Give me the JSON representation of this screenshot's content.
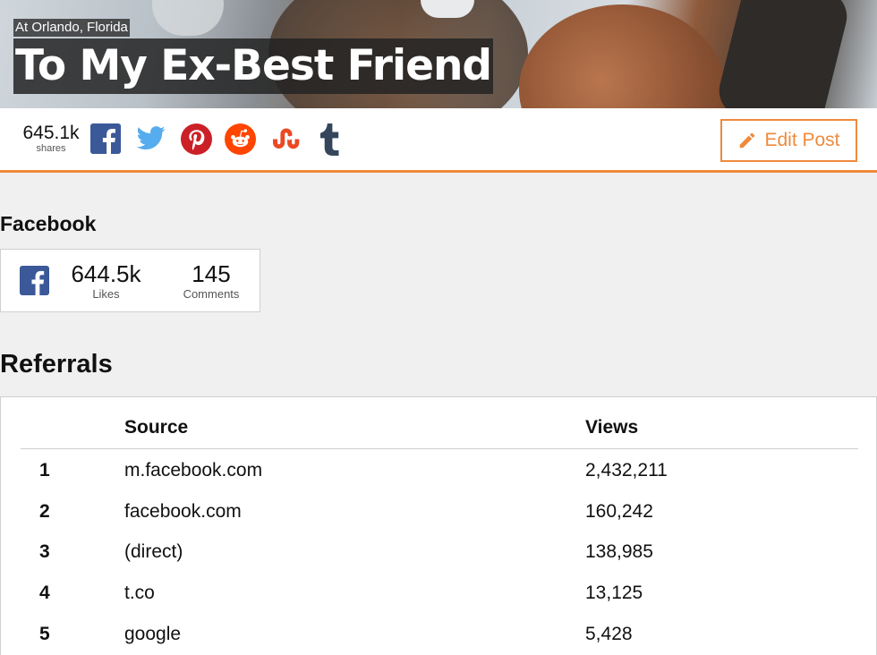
{
  "hero": {
    "location": "At Orlando, Florida",
    "title": "To My Ex-Best Friend"
  },
  "sharebar": {
    "share_count": "645.1k",
    "share_label": "shares",
    "edit_label": "Edit Post",
    "accent_color": "#ef8a3c"
  },
  "facebook": {
    "heading": "Facebook",
    "likes": "644.5k",
    "likes_label": "Likes",
    "comments": "145",
    "comments_label": "Comments"
  },
  "referrals": {
    "heading": "Referrals",
    "columns": [
      "Source",
      "Views"
    ],
    "rows": [
      {
        "rank": "1",
        "source": "m.facebook.com",
        "views": "2,432,211"
      },
      {
        "rank": "2",
        "source": "facebook.com",
        "views": "160,242"
      },
      {
        "rank": "3",
        "source": "(direct)",
        "views": "138,985"
      },
      {
        "rank": "4",
        "source": "t.co",
        "views": "13,125"
      },
      {
        "rank": "5",
        "source": "google",
        "views": "5,428"
      }
    ]
  }
}
